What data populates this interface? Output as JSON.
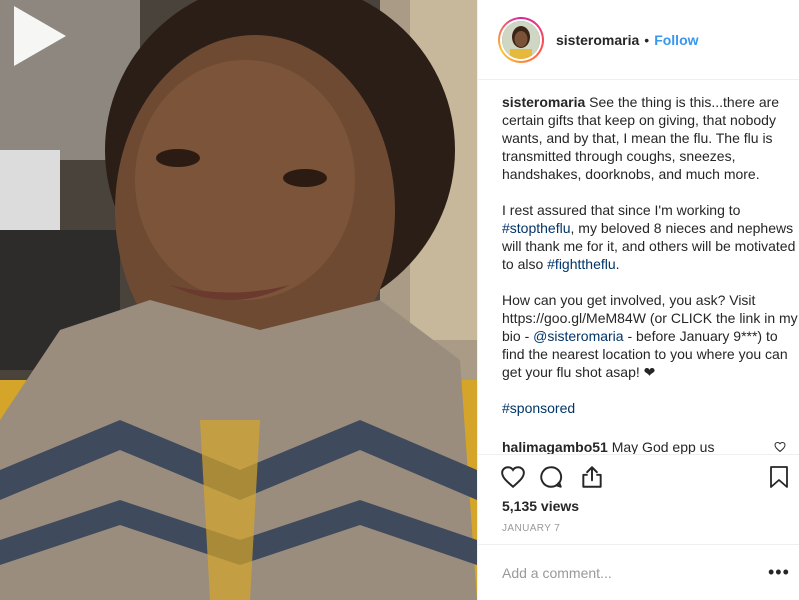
{
  "post": {
    "username": "sisteromaria",
    "header_dot": "•",
    "follow_label": "Follow"
  },
  "caption": {
    "username": "sisteromaria",
    "p1": " See the thing is this...there are certain gifts that keep on giving, that nobody wants, and by that, I mean the flu. The flu is transmitted through coughs, sneezes, handshakes, doorknobs, and much more.",
    "p2_a": "I rest assured that since I'm working to ",
    "p2_tag1": "#stoptheflu",
    "p2_b": ", my beloved 8 nieces and nephews will thank me for it, and others will be motivated to also ",
    "p2_tag2": "#fighttheflu",
    "p2_c": ".",
    "p3_a": "How can you get involved, you ask? Visit https://goo.gl/MeM84W (or CLICK the link in my bio - ",
    "p3_mention": "@sisteromaria",
    "p3_b": " - before January 9***) to find the nearest location to you where you can get your flu shot asap! ❤",
    "p4_tag": "#sponsored"
  },
  "comment": {
    "username": "halimagambo51",
    "text": " May God epp us"
  },
  "stats": {
    "views": "5,135 views",
    "date": "JANUARY 7"
  },
  "add_comment": {
    "placeholder": "Add a comment...",
    "more_label": "•••"
  },
  "icons": {
    "play": "play-icon",
    "like": "heart-icon",
    "comment": "comment-icon",
    "share": "share-icon",
    "save": "bookmark-icon",
    "comment_like": "small-heart-icon"
  },
  "colors": {
    "link_blue": "#3897f0",
    "hashtag": "#003569",
    "muted": "#999999"
  }
}
